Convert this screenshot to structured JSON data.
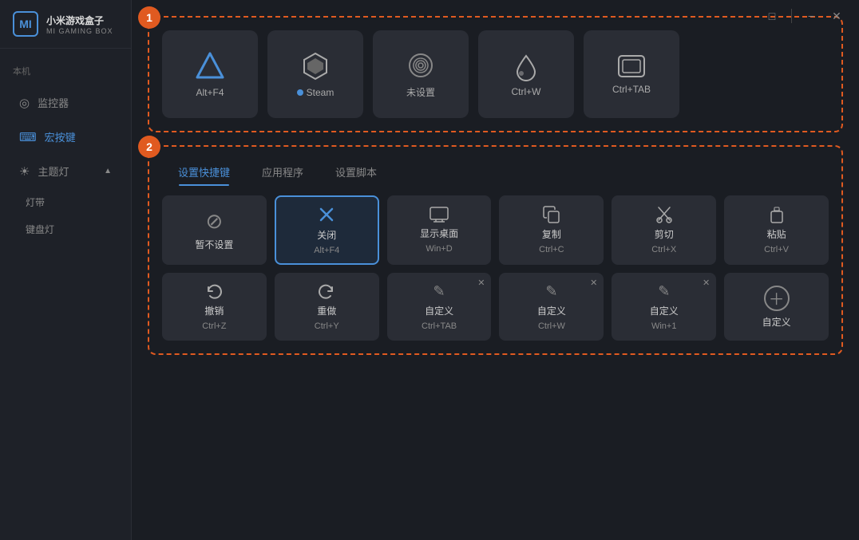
{
  "app": {
    "title": "小米游戏盒子",
    "subtitle": "MI GAMING BOX"
  },
  "titlebar": {
    "minimize_label": "−",
    "maximize_label": "□",
    "close_label": "✕"
  },
  "sidebar": {
    "section_label": "本机",
    "items": [
      {
        "id": "monitor",
        "label": "监控器",
        "icon": "◎",
        "active": false
      },
      {
        "id": "macro",
        "label": "宏按键",
        "icon": "⌨",
        "active": true
      },
      {
        "id": "theme",
        "label": "主题灯",
        "icon": "☀",
        "active": false,
        "expanded": true
      }
    ],
    "sub_items": [
      {
        "id": "strip",
        "label": "灯带"
      },
      {
        "id": "keyboard",
        "label": "键盘灯"
      }
    ]
  },
  "section1": {
    "badge": "1",
    "cards": [
      {
        "id": "alt-f4",
        "icon": "▲",
        "label": "Alt+F4",
        "icon_type": "triangle"
      },
      {
        "id": "steam",
        "icon": "⬡",
        "label": "Steam",
        "icon_type": "steam"
      },
      {
        "id": "unset",
        "icon": "◎",
        "label": "未设置",
        "icon_type": "spiral"
      },
      {
        "id": "ctrl-w",
        "icon": "◇",
        "label": "Ctrl+W",
        "icon_type": "drop"
      },
      {
        "id": "ctrl-tab",
        "icon": "▭",
        "label": "Ctrl+TAB",
        "icon_type": "rect"
      }
    ]
  },
  "section2": {
    "badge": "2",
    "tabs": [
      {
        "id": "shortcuts",
        "label": "设置快捷键",
        "active": true
      },
      {
        "id": "apps",
        "label": "应用程序",
        "active": false
      },
      {
        "id": "scripts",
        "label": "设置脚本",
        "active": false
      }
    ],
    "row1": [
      {
        "id": "no-set",
        "title": "暂不设置",
        "sub": "",
        "type": "noset",
        "selected": false
      },
      {
        "id": "close",
        "title": "关闭",
        "sub": "Alt+F4",
        "type": "action",
        "selected": true
      },
      {
        "id": "desktop",
        "title": "显示桌面",
        "sub": "Win+D",
        "type": "action",
        "selected": false
      },
      {
        "id": "copy",
        "title": "复制",
        "sub": "Ctrl+C",
        "type": "action",
        "selected": false
      },
      {
        "id": "cut",
        "title": "剪切",
        "sub": "Ctrl+X",
        "type": "action",
        "selected": false
      },
      {
        "id": "paste",
        "title": "粘贴",
        "sub": "Ctrl+V",
        "type": "action",
        "selected": false
      }
    ],
    "row2": [
      {
        "id": "undo",
        "title": "撤销",
        "sub": "Ctrl+Z",
        "type": "action",
        "selected": false,
        "closable": false
      },
      {
        "id": "redo",
        "title": "重做",
        "sub": "Ctrl+Y",
        "type": "action",
        "selected": false,
        "closable": false
      },
      {
        "id": "custom1",
        "title": "自定义",
        "sub": "Ctrl+TAB",
        "type": "custom",
        "selected": false,
        "closable": true
      },
      {
        "id": "custom2",
        "title": "自定义",
        "sub": "Ctrl+W",
        "type": "custom",
        "selected": false,
        "closable": true
      },
      {
        "id": "custom3",
        "title": "自定义",
        "sub": "Win+1",
        "type": "custom",
        "selected": false,
        "closable": true
      },
      {
        "id": "add-custom",
        "title": "自定义",
        "sub": "",
        "type": "add",
        "selected": false,
        "closable": false
      }
    ]
  }
}
